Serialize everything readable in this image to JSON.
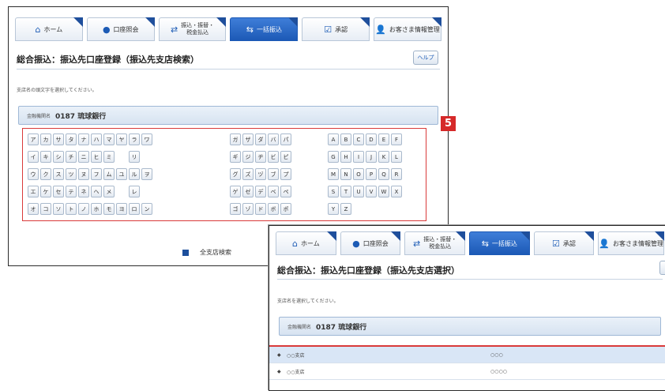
{
  "nav": {
    "tabs": [
      {
        "label": "ホーム",
        "icon": "home-icon",
        "glyph": "⌂"
      },
      {
        "label": "口座照会",
        "icon": "account-icon",
        "glyph": "●"
      },
      {
        "label_line1": "振込・振替・",
        "label_line2": "税金払込",
        "icon": "transfer-icon",
        "glyph": "⇄"
      },
      {
        "label": "一括振込",
        "icon": "bulk-transfer-icon",
        "glyph": "⇆",
        "active": true
      },
      {
        "label": "承認",
        "icon": "approve-icon",
        "glyph": "☑"
      },
      {
        "label": "お客さま情報管理",
        "icon": "user-icon",
        "glyph": "👤"
      }
    ]
  },
  "screen1": {
    "title": "総合振込：振込先口座登録（振込先支店検索）",
    "help_label": "ヘルプ",
    "instruction": "支店名の頭文字を選択してください。",
    "bank_label": "金融機関名",
    "bank_value": "0187 琉球銀行",
    "search_all_label": "全支店検索",
    "marker": "5",
    "kana_group1": [
      [
        "ア",
        "カ",
        "サ",
        "タ",
        "ナ",
        "ハ",
        "マ",
        "ヤ",
        "ラ",
        "ワ"
      ],
      [
        "イ",
        "キ",
        "シ",
        "チ",
        "ニ",
        "ヒ",
        "ミ",
        "",
        "リ",
        ""
      ],
      [
        "ウ",
        "ク",
        "ス",
        "ツ",
        "ヌ",
        "フ",
        "ム",
        "ユ",
        "ル",
        "ヲ"
      ],
      [
        "エ",
        "ケ",
        "セ",
        "テ",
        "ネ",
        "ヘ",
        "メ",
        "",
        "レ",
        ""
      ],
      [
        "オ",
        "コ",
        "ソ",
        "ト",
        "ノ",
        "ホ",
        "モ",
        "ヨ",
        "ロ",
        "ン"
      ]
    ],
    "kana_group2": [
      [
        "ガ",
        "ザ",
        "ダ",
        "バ",
        "パ"
      ],
      [
        "ギ",
        "ジ",
        "ヂ",
        "ビ",
        "ピ"
      ],
      [
        "グ",
        "ズ",
        "ヅ",
        "ブ",
        "プ"
      ],
      [
        "ゲ",
        "ゼ",
        "デ",
        "ベ",
        "ペ"
      ],
      [
        "ゴ",
        "ゾ",
        "ド",
        "ボ",
        "ポ"
      ]
    ],
    "alpha_group": [
      [
        "A",
        "B",
        "C",
        "D",
        "E",
        "F"
      ],
      [
        "G",
        "H",
        "I",
        "J",
        "K",
        "L"
      ],
      [
        "M",
        "N",
        "O",
        "P",
        "Q",
        "R"
      ],
      [
        "S",
        "T",
        "U",
        "V",
        "W",
        "X"
      ],
      [
        "Y",
        "Z"
      ]
    ]
  },
  "screen2": {
    "title": "総合振込：振込先口座登録（振込先支店選択）",
    "instruction": "支店名を選択してください。",
    "bank_label": "金融機関名",
    "bank_value": "0187 琉球銀行",
    "rows": [
      {
        "bullet": "◆",
        "name": "○○支店",
        "code": "○○○"
      },
      {
        "bullet": "◆",
        "name": "○○支店",
        "code": "○○○○"
      }
    ]
  },
  "colors": {
    "accent": "#1c59b6",
    "highlight": "#d93a3a"
  }
}
